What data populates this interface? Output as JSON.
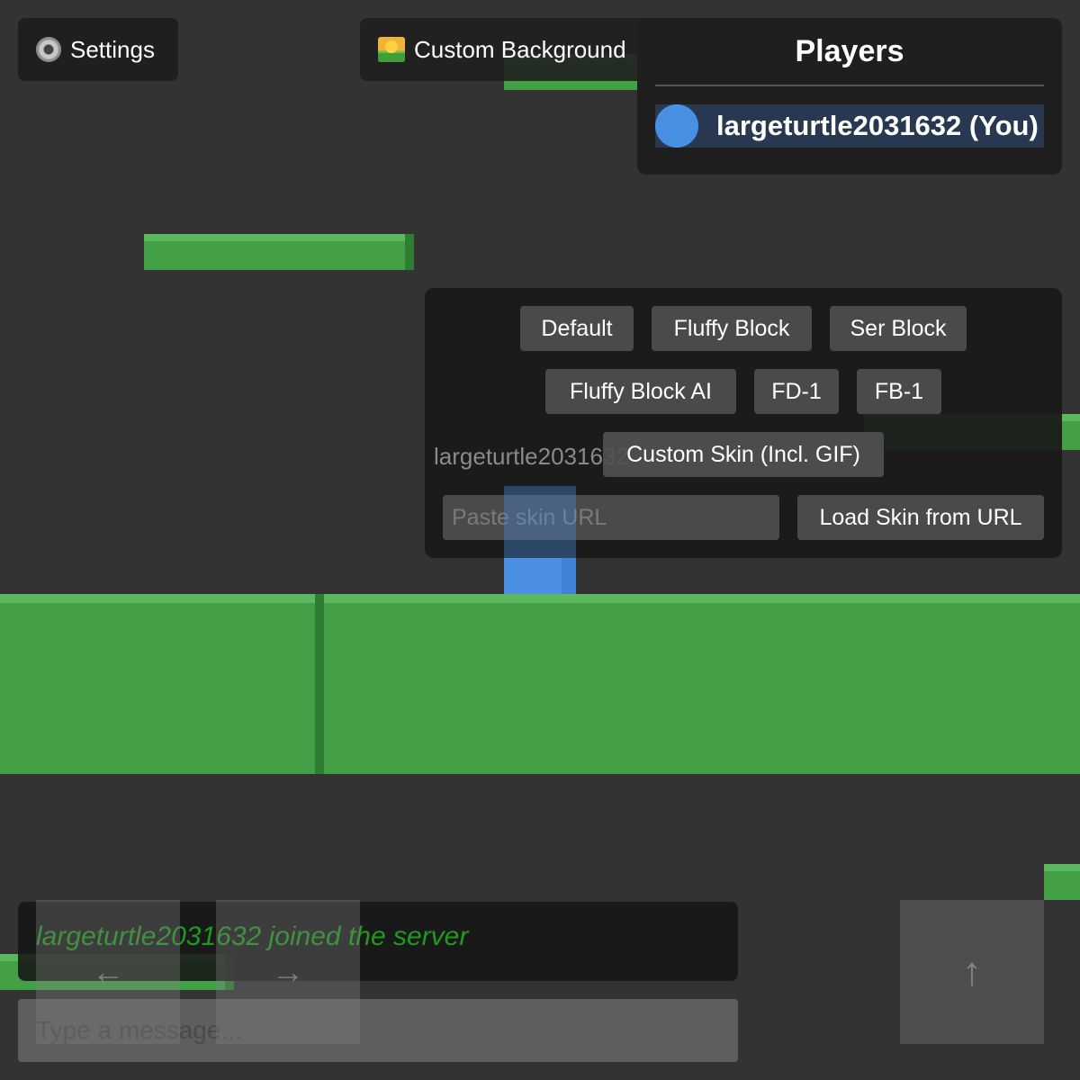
{
  "hud": {
    "settings_label": "Settings",
    "settings_icon": "gear-icon",
    "background_label": "Custom Background",
    "background_icon": "landscape-icon"
  },
  "players": {
    "title": "Players",
    "list": [
      {
        "name": "largeturtle2031632 (You)",
        "color": "#4a90e2"
      }
    ]
  },
  "skins": {
    "row1": [
      "Default",
      "Fluffy Block",
      "Ser Block"
    ],
    "row2": [
      "Fluffy Block AI",
      "FD-1",
      "FB-1"
    ],
    "player_label": "largeturtle2031632",
    "custom_skin_label": "Custom Skin (Incl. GIF)",
    "url_placeholder": "Paste skin URL",
    "load_button": "Load Skin from URL"
  },
  "chat": {
    "messages": [
      "largeturtle2031632 joined the server"
    ],
    "message_color": "#1f9a1f",
    "input_placeholder": "Type a message..."
  },
  "controls": {
    "left": "←",
    "right": "→",
    "jump": "↑"
  },
  "colors": {
    "background": "#333333",
    "platform": "#43a047",
    "player": "#4a90e2"
  }
}
